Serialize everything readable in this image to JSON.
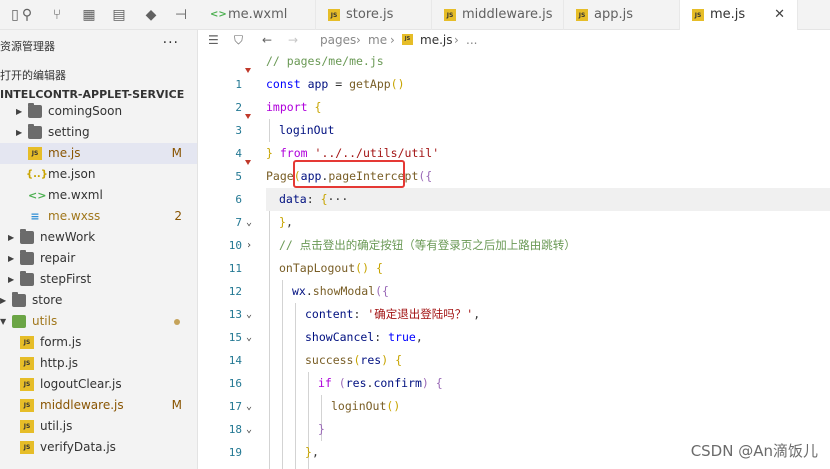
{
  "sidebar": {
    "title": "资源管理器",
    "more": "···",
    "open_editors": "打开的编辑器",
    "project": "INTELCONTR-APPLET-SERVICE",
    "items": [
      {
        "label": "comingSoon",
        "type": "folder",
        "state": "collapsed"
      },
      {
        "label": "setting",
        "type": "folder",
        "state": "collapsed"
      },
      {
        "label": "me.js",
        "type": "js",
        "badge": "M"
      },
      {
        "label": "me.json",
        "type": "json"
      },
      {
        "label": "me.wxml",
        "type": "wxml"
      },
      {
        "label": "me.wxss",
        "type": "wxss",
        "badge": "2"
      },
      {
        "label": "newWork",
        "type": "folder",
        "state": "collapsed"
      },
      {
        "label": "repair",
        "type": "folder",
        "state": "collapsed"
      },
      {
        "label": "stepFirst",
        "type": "folder",
        "state": "collapsed"
      },
      {
        "label": "store",
        "type": "folder",
        "state": "collapsed"
      },
      {
        "label": "utils",
        "type": "folder-open"
      },
      {
        "label": "form.js",
        "type": "js"
      },
      {
        "label": "http.js",
        "type": "js"
      },
      {
        "label": "logoutClear.js",
        "type": "js"
      },
      {
        "label": "middleware.js",
        "type": "js",
        "badge": "M"
      },
      {
        "label": "util.js",
        "type": "js"
      },
      {
        "label": "verifyData.js",
        "type": "js"
      }
    ]
  },
  "tabs": [
    {
      "label": "me.wxml",
      "type": "wxml"
    },
    {
      "label": "store.js",
      "type": "js"
    },
    {
      "label": "middleware.js",
      "type": "js"
    },
    {
      "label": "app.js",
      "type": "js"
    },
    {
      "label": "me.js",
      "type": "js",
      "active": true,
      "close": "✕"
    }
  ],
  "breadcrumb": {
    "parts": [
      "pages",
      "me",
      "me.js",
      "..."
    ]
  },
  "editor": {
    "lines": [
      {
        "num": "1",
        "text": "// pages/me/me.js"
      },
      {
        "num": "2",
        "text": "const app = getApp()"
      },
      {
        "num": "3",
        "text": "import {"
      },
      {
        "num": "4",
        "text": "loginOut"
      },
      {
        "num": "5",
        "text": "} from '../../utils/util'"
      },
      {
        "num": "6",
        "text": "Page(app.pageIntercept({"
      },
      {
        "num": "7",
        "text": "data: {···"
      },
      {
        "num": "10",
        "text": "},"
      },
      {
        "num": "11",
        "text": "// 点击登出的确定按钮（等有登录页之后加上路由跳转）"
      },
      {
        "num": "12",
        "text": "onTapLogout() {"
      },
      {
        "num": "13",
        "text": "wx.showModal({"
      },
      {
        "num": "15",
        "text": "content: '确定退出登陆吗？',"
      },
      {
        "num": "14",
        "text": "showCancel: true,"
      },
      {
        "num": "16",
        "text": "success(res) {"
      },
      {
        "num": "17",
        "text": "if (res.confirm) {"
      },
      {
        "num": "18",
        "text": "loginOut()"
      },
      {
        "num": "19",
        "text": "}"
      },
      {
        "num": "20",
        "text": "},"
      }
    ]
  },
  "watermark": "CSDN @An滴饭儿"
}
